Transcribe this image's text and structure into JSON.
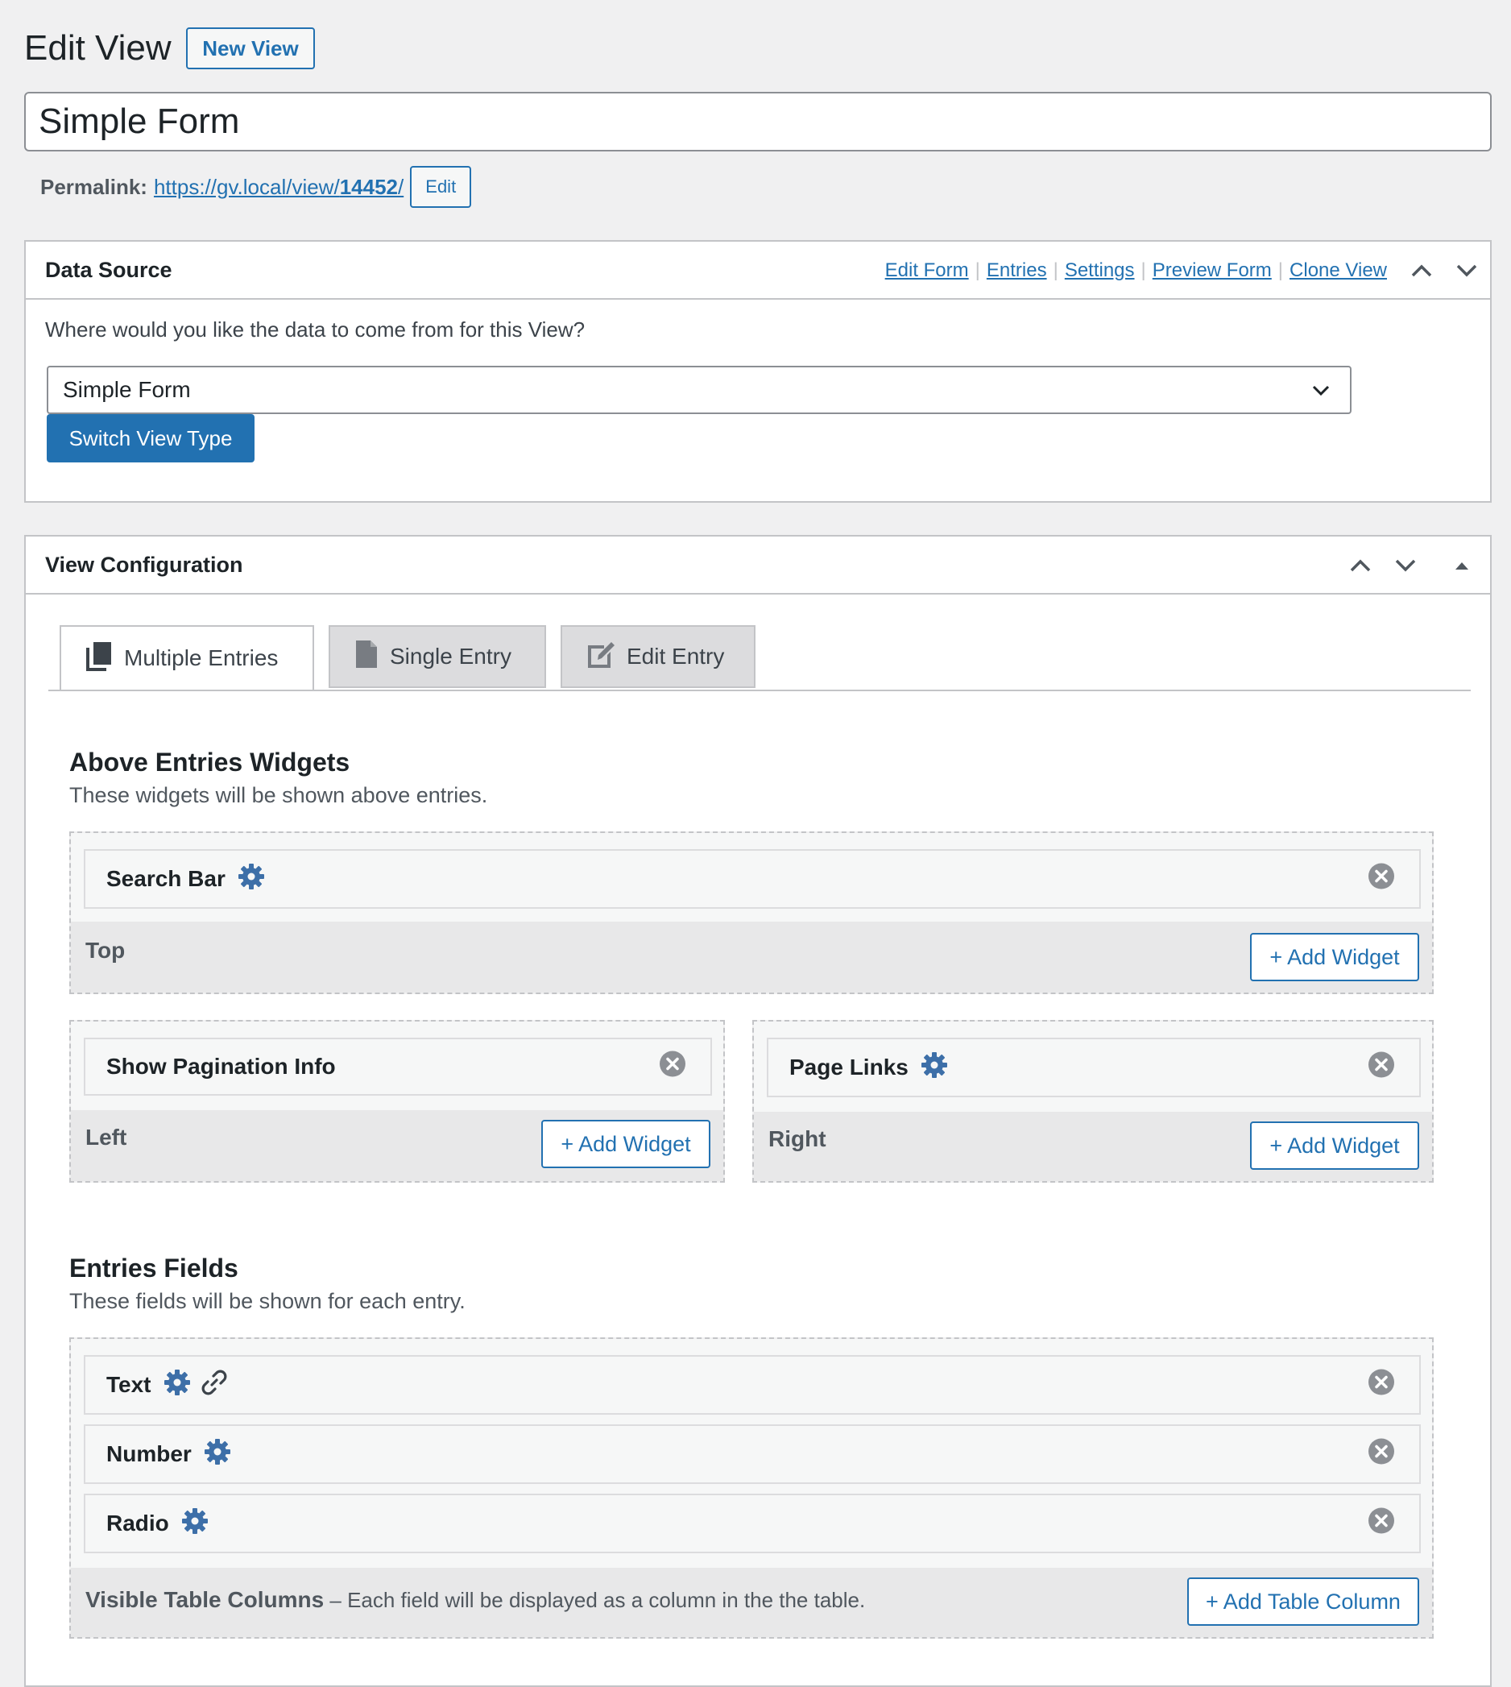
{
  "header": {
    "title": "Edit View",
    "new_view_label": "New View",
    "view_title_value": "Simple Form",
    "permalink_label": "Permalink:",
    "permalink_url_prefix": "https://gv.local/view/",
    "permalink_url_id": "14452",
    "permalink_url_suffix": "/",
    "permalink_edit_label": "Edit"
  },
  "data_source": {
    "title": "Data Source",
    "links": [
      "Edit Form",
      "Entries",
      "Settings",
      "Preview Form",
      "Clone View"
    ],
    "question": "Where would you like the data to come from for this View?",
    "selected_form": "Simple Form",
    "switch_label": "Switch View Type"
  },
  "view_config": {
    "title": "View Configuration",
    "tabs": [
      {
        "label": "Multiple Entries",
        "icon": "multiple-entries-icon",
        "active": true
      },
      {
        "label": "Single Entry",
        "icon": "single-entry-icon",
        "active": false
      },
      {
        "label": "Edit Entry",
        "icon": "edit-entry-icon",
        "active": false
      }
    ],
    "widgets_section": {
      "title": "Above Entries Widgets",
      "description": "These widgets will be shown above entries.",
      "top": {
        "label": "Top",
        "items": [
          "Search Bar"
        ],
        "add_label": "+ Add Widget"
      },
      "left": {
        "label": "Left",
        "items": [
          "Show Pagination Info"
        ],
        "add_label": "+ Add Widget"
      },
      "right": {
        "label": "Right",
        "items": [
          "Page Links"
        ],
        "add_label": "+ Add Widget"
      }
    },
    "fields_section": {
      "title": "Entries Fields",
      "description": "These fields will be shown for each entry.",
      "items": [
        "Text",
        "Number",
        "Radio"
      ],
      "footer_bold": "Visible Table Columns",
      "footer_text": " – Each field will be displayed as a column in the the table.",
      "add_label": "+ Add Table Column"
    }
  },
  "colors": {
    "accent": "#2271b1",
    "gear": "#3d6fa8",
    "close": "#8c8f94"
  }
}
